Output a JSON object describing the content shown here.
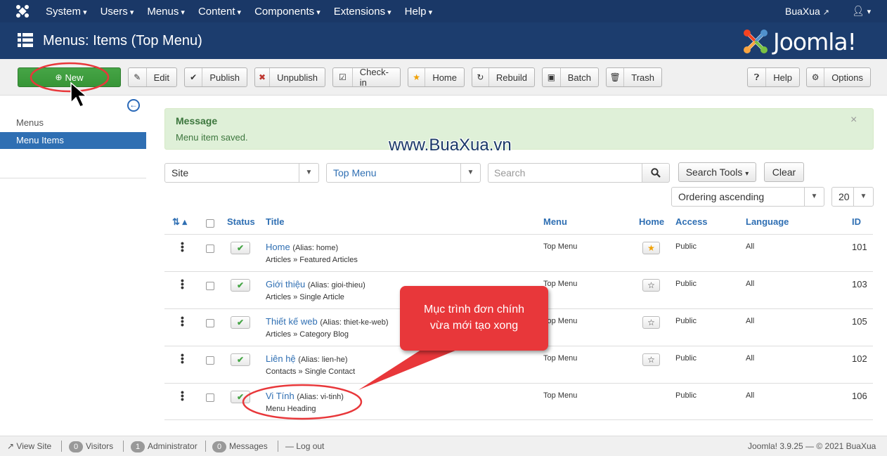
{
  "topnav": {
    "items": [
      "System",
      "Users",
      "Menus",
      "Content",
      "Components",
      "Extensions",
      "Help"
    ],
    "site_label": "BuaXua",
    "user_icon": "user-icon"
  },
  "header": {
    "title": "Menus: Items (Top Menu)",
    "brand": "Joomla!"
  },
  "toolbar": {
    "buttons": [
      "New",
      "Edit",
      "Publish",
      "Unpublish",
      "Check-in",
      "Home",
      "Rebuild",
      "Batch",
      "Trash",
      "Help",
      "Options"
    ]
  },
  "sidebar": {
    "items": [
      "Menus",
      "Menu Items"
    ],
    "active": "Menu Items"
  },
  "message": {
    "heading": "Message",
    "text": "Menu item saved.",
    "close": "×"
  },
  "filters": {
    "site": "Site",
    "menu": "Top Menu",
    "search_placeholder": "Search",
    "search_tools": "Search Tools",
    "clear": "Clear",
    "ordering": "Ordering ascending",
    "limit": "20"
  },
  "table": {
    "headers": {
      "status": "Status",
      "title": "Title",
      "menu": "Menu",
      "home": "Home",
      "access": "Access",
      "language": "Language",
      "id": "ID"
    },
    "rows": [
      {
        "title": "Home",
        "alias": "(Alias: home)",
        "type": "Articles » Featured Articles",
        "menu": "Top Menu",
        "home": true,
        "access": "Public",
        "language": "All",
        "id": "101"
      },
      {
        "title": "Giới thiệu",
        "alias": "(Alias: gioi-thieu)",
        "type": "Articles » Single Article",
        "menu": "Top Menu",
        "home": false,
        "access": "Public",
        "language": "All",
        "id": "103"
      },
      {
        "title": "Thiết kế web",
        "alias": "(Alias: thiet-ke-web)",
        "type": "Articles » Category Blog",
        "menu": "Top Menu",
        "home": false,
        "access": "Public",
        "language": "All",
        "id": "105"
      },
      {
        "title": "Liên hệ",
        "alias": "(Alias: lien-he)",
        "type": "Contacts » Single Contact",
        "menu": "Top Menu",
        "home": false,
        "access": "Public",
        "language": "All",
        "id": "102"
      },
      {
        "title": "Vi Tính",
        "alias": "(Alias: vi-tinh)",
        "type": "Menu Heading",
        "menu": "Top Menu",
        "home": null,
        "access": "Public",
        "language": "All",
        "id": "106"
      }
    ]
  },
  "footer": {
    "view_site": "View Site",
    "visitors_count": "0",
    "visitors": "Visitors",
    "admin_count": "1",
    "administrator": "Administrator",
    "messages_count": "0",
    "messages": "Messages",
    "logout": "Log out",
    "version": "Joomla! 3.9.25  —  © 2021 BuaXua"
  },
  "annotation": {
    "watermark": "www.BuaXua.vn",
    "callout": [
      "Mục trình đơn chính",
      "vừa mới tạo xong"
    ],
    "accent": "#e8373a"
  }
}
